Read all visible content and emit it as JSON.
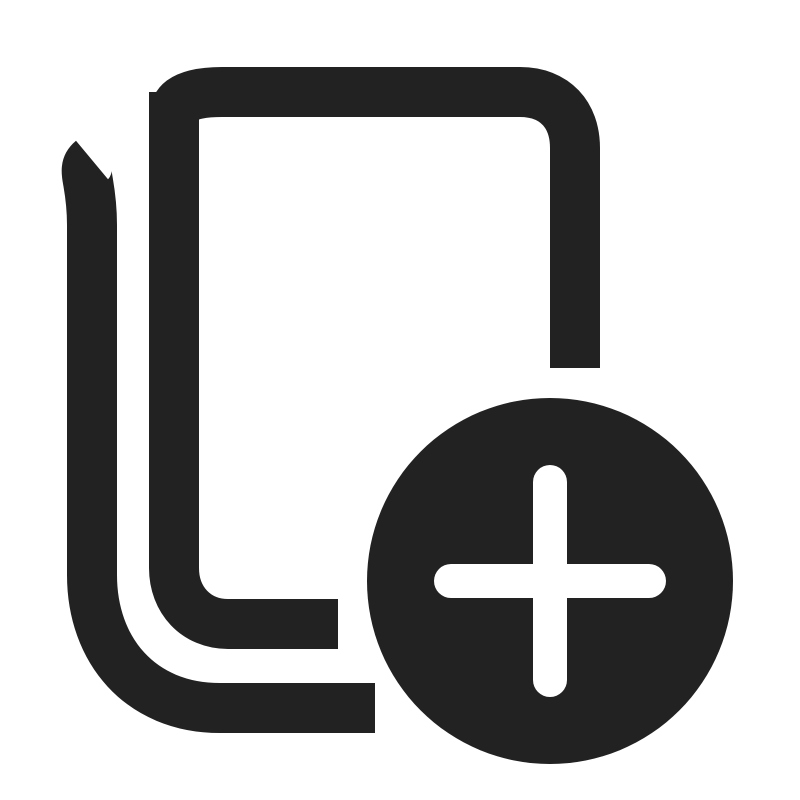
{
  "icon": {
    "name": "add-pages-icon",
    "glyph_color": "#222222",
    "background_color": "#ffffff",
    "parts": [
      "back-page-icon",
      "front-page-icon",
      "add-circle-icon",
      "plus-icon"
    ]
  }
}
